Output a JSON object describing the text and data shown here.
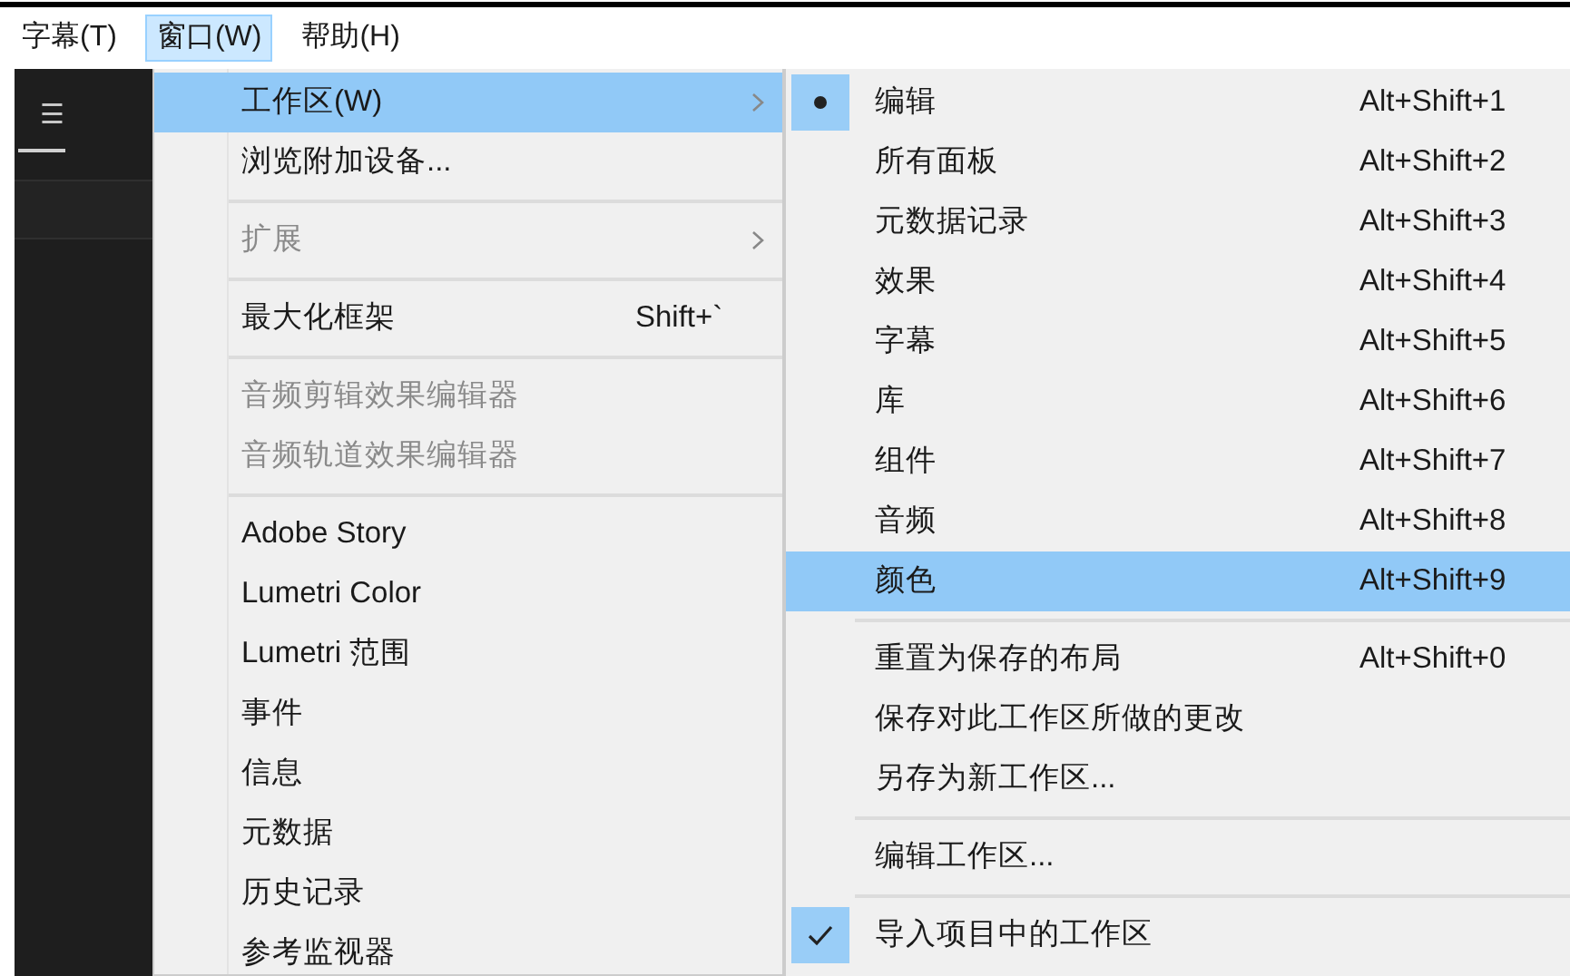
{
  "menubar": [
    {
      "label": "字幕(T)",
      "selected": false
    },
    {
      "label": "窗口(W)",
      "selected": true
    },
    {
      "label": "帮助(H)",
      "selected": false
    }
  ],
  "panel": {
    "menu_glyph": "☰"
  },
  "window_menu": {
    "items": [
      {
        "kind": "item",
        "label": "工作区(W)",
        "selected": true,
        "disabled": false,
        "submenu": true
      },
      {
        "kind": "item",
        "label": "浏览附加设备...",
        "selected": false,
        "disabled": false,
        "submenu": false
      },
      {
        "kind": "separator"
      },
      {
        "kind": "item",
        "label": "扩展",
        "selected": false,
        "disabled": true,
        "submenu": true
      },
      {
        "kind": "separator"
      },
      {
        "kind": "item",
        "label": "最大化框架",
        "shortcut": "Shift+`",
        "selected": false,
        "disabled": false,
        "submenu": false
      },
      {
        "kind": "separator"
      },
      {
        "kind": "item",
        "label": "音频剪辑效果编辑器",
        "selected": false,
        "disabled": true,
        "submenu": false
      },
      {
        "kind": "item",
        "label": "音频轨道效果编辑器",
        "selected": false,
        "disabled": true,
        "submenu": false
      },
      {
        "kind": "separator"
      },
      {
        "kind": "item",
        "label": "Adobe Story",
        "selected": false,
        "disabled": false,
        "submenu": false
      },
      {
        "kind": "item",
        "label": "Lumetri Color",
        "selected": false,
        "disabled": false,
        "submenu": false
      },
      {
        "kind": "item",
        "label": "Lumetri 范围",
        "selected": false,
        "disabled": false,
        "submenu": false
      },
      {
        "kind": "item",
        "label": "事件",
        "selected": false,
        "disabled": false,
        "submenu": false
      },
      {
        "kind": "item",
        "label": "信息",
        "selected": false,
        "disabled": false,
        "submenu": false
      },
      {
        "kind": "item",
        "label": "元数据",
        "selected": false,
        "disabled": false,
        "submenu": false
      },
      {
        "kind": "item",
        "label": "历史记录",
        "selected": false,
        "disabled": false,
        "submenu": false
      },
      {
        "kind": "item",
        "label": "参考监视器",
        "selected": false,
        "disabled": false,
        "submenu": false
      }
    ]
  },
  "workspace_submenu": {
    "items": [
      {
        "kind": "item",
        "label": "编辑",
        "shortcut": "Alt+Shift+1",
        "bullet": true,
        "checked": false,
        "selected": false
      },
      {
        "kind": "item",
        "label": "所有面板",
        "shortcut": "Alt+Shift+2",
        "bullet": false,
        "checked": false,
        "selected": false
      },
      {
        "kind": "item",
        "label": "元数据记录",
        "shortcut": "Alt+Shift+3",
        "bullet": false,
        "checked": false,
        "selected": false
      },
      {
        "kind": "item",
        "label": "效果",
        "shortcut": "Alt+Shift+4",
        "bullet": false,
        "checked": false,
        "selected": false
      },
      {
        "kind": "item",
        "label": "字幕",
        "shortcut": "Alt+Shift+5",
        "bullet": false,
        "checked": false,
        "selected": false
      },
      {
        "kind": "item",
        "label": "库",
        "shortcut": "Alt+Shift+6",
        "bullet": false,
        "checked": false,
        "selected": false
      },
      {
        "kind": "item",
        "label": "组件",
        "shortcut": "Alt+Shift+7",
        "bullet": false,
        "checked": false,
        "selected": false
      },
      {
        "kind": "item",
        "label": "音频",
        "shortcut": "Alt+Shift+8",
        "bullet": false,
        "checked": false,
        "selected": false
      },
      {
        "kind": "item",
        "label": "颜色",
        "shortcut": "Alt+Shift+9",
        "bullet": false,
        "checked": false,
        "selected": true
      },
      {
        "kind": "separator"
      },
      {
        "kind": "item",
        "label": "重置为保存的布局",
        "shortcut": "Alt+Shift+0",
        "bullet": false,
        "checked": false,
        "selected": false
      },
      {
        "kind": "item",
        "label": "保存对此工作区所做的更改",
        "bullet": false,
        "checked": false,
        "selected": false
      },
      {
        "kind": "item",
        "label": "另存为新工作区...",
        "bullet": false,
        "checked": false,
        "selected": false
      },
      {
        "kind": "separator"
      },
      {
        "kind": "item",
        "label": "编辑工作区...",
        "bullet": false,
        "checked": false,
        "selected": false
      },
      {
        "kind": "separator"
      },
      {
        "kind": "item",
        "label": "导入项目中的工作区",
        "bullet": false,
        "checked": true,
        "selected": false
      }
    ]
  }
}
